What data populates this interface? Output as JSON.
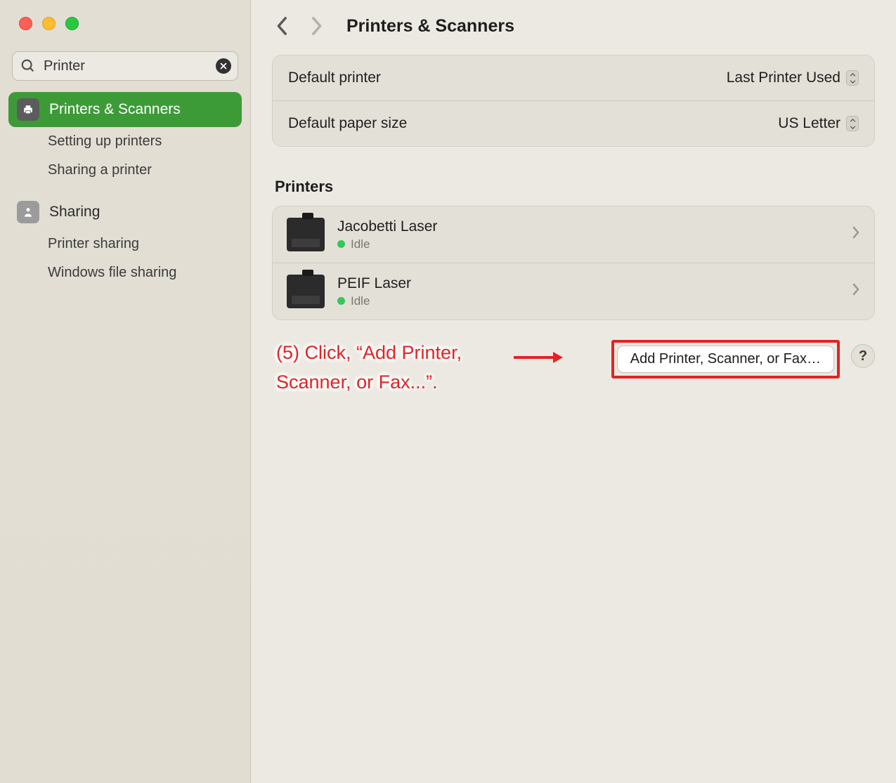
{
  "search": {
    "value": "Printer"
  },
  "sidebar": {
    "items": [
      {
        "label": "Printers & Scanners"
      },
      {
        "label": "Setting up printers"
      },
      {
        "label": "Sharing a printer"
      },
      {
        "label": "Sharing"
      },
      {
        "label": "Printer sharing"
      },
      {
        "label": "Windows file sharing"
      }
    ]
  },
  "header": {
    "title": "Printers & Scanners"
  },
  "settings": {
    "default_printer": {
      "label": "Default printer",
      "value": "Last Printer Used"
    },
    "default_paper": {
      "label": "Default paper size",
      "value": "US Letter"
    }
  },
  "printers": {
    "section_title": "Printers",
    "list": [
      {
        "name": "Jacobetti Laser",
        "status": "Idle"
      },
      {
        "name": "PEIF Laser",
        "status": "Idle"
      }
    ]
  },
  "actions": {
    "add_button": "Add Printer, Scanner, or Fax…",
    "help": "?"
  },
  "annotation": {
    "text": "(5) Click, “Add Printer, Scanner, or Fax...”."
  }
}
